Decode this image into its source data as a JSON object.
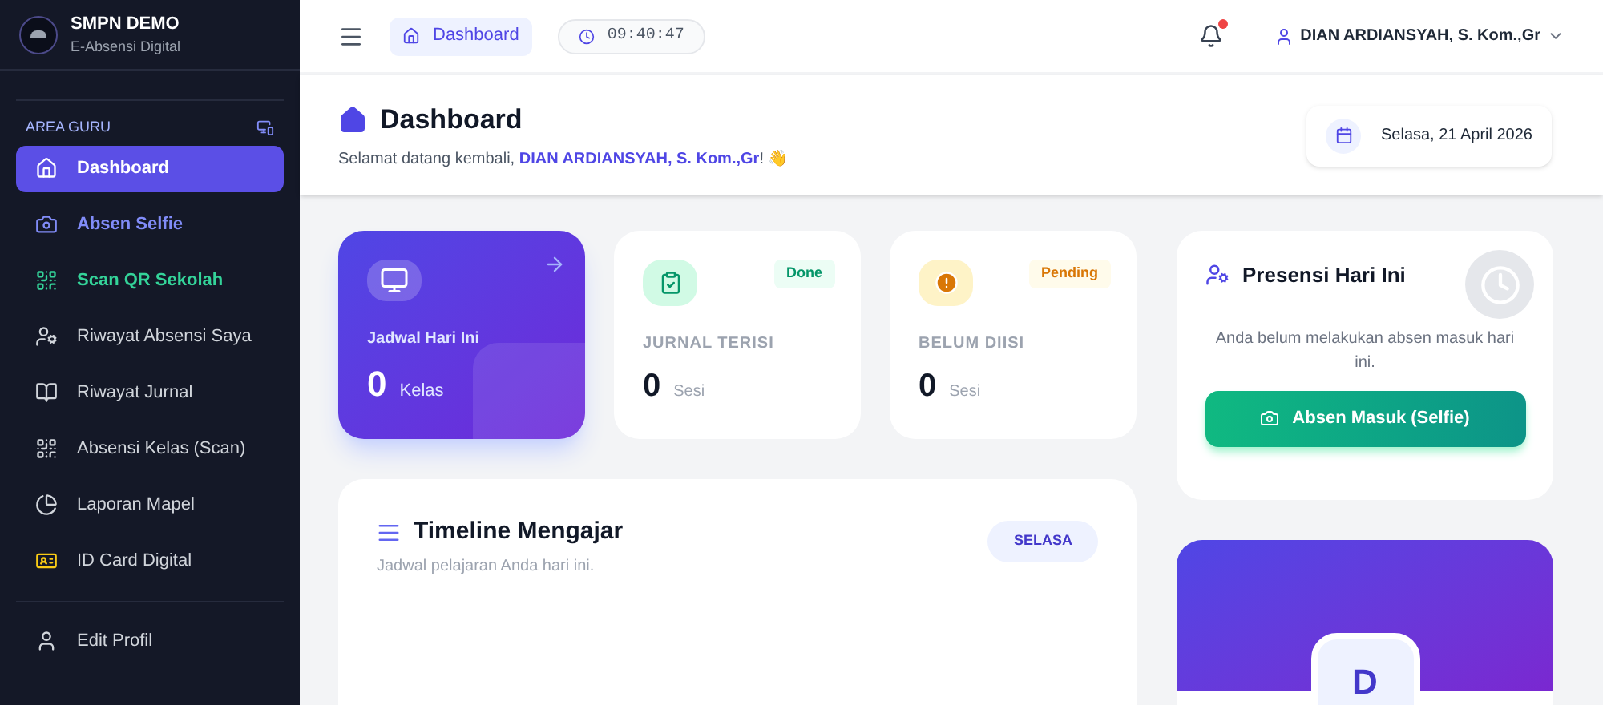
{
  "brand": {
    "name": "SMPN DEMO",
    "subtitle": "E-Absensi Digital"
  },
  "sidebar": {
    "section": "AREA GURU",
    "items": [
      {
        "label": "Dashboard",
        "selected": true
      },
      {
        "label": "Absen Selfie",
        "selected": false,
        "color": "#818cf8"
      },
      {
        "label": "Scan QR Sekolah",
        "selected": false,
        "color": "#34d399"
      },
      {
        "label": "Riwayat Absensi Saya",
        "selected": false
      },
      {
        "label": "Riwayat Jurnal",
        "selected": false
      },
      {
        "label": "Absensi Kelas (Scan)",
        "selected": false
      },
      {
        "label": "Laporan Mapel",
        "selected": false
      },
      {
        "label": "ID Card Digital",
        "selected": false
      }
    ],
    "footer_item": {
      "label": "Edit Profil",
      "selected": false
    }
  },
  "topbar": {
    "breadcrumb": "Dashboard",
    "clock": "09:40:47",
    "notification_dot": true,
    "user": "DIAN ARDIANSYAH, S. Kom.,Gr"
  },
  "page": {
    "title": "Dashboard",
    "greeting": "Selamat datang kembali, **DIAN ARDIANSYAH, S. Kom.,Gr**! 👋",
    "date": "Selasa, 21 April 2026"
  },
  "stats": [
    {
      "kind": "primary",
      "label": "Jadwal Hari Ini",
      "value": "0",
      "unit": "Kelas"
    },
    {
      "kind": "status",
      "label": "JURNAL TERISI",
      "value": "0",
      "unit": "Sesi",
      "badge": "Done",
      "color": "#059669"
    },
    {
      "kind": "status",
      "label": "BELUM DIISI",
      "value": "0",
      "unit": "Sesi",
      "badge": "Pending",
      "color": "#d97706"
    }
  ],
  "timeline": {
    "title": "Timeline Mengajar",
    "subtitle": "Jadwal pelajaran Anda hari ini.",
    "day": "SELASA"
  },
  "presence": {
    "title": "Presensi Hari Ini",
    "message": "Anda belum melakukan absen masuk hari ini.",
    "button": "Absen Masuk (Selfie)"
  },
  "profile": {
    "initial": "D"
  }
}
